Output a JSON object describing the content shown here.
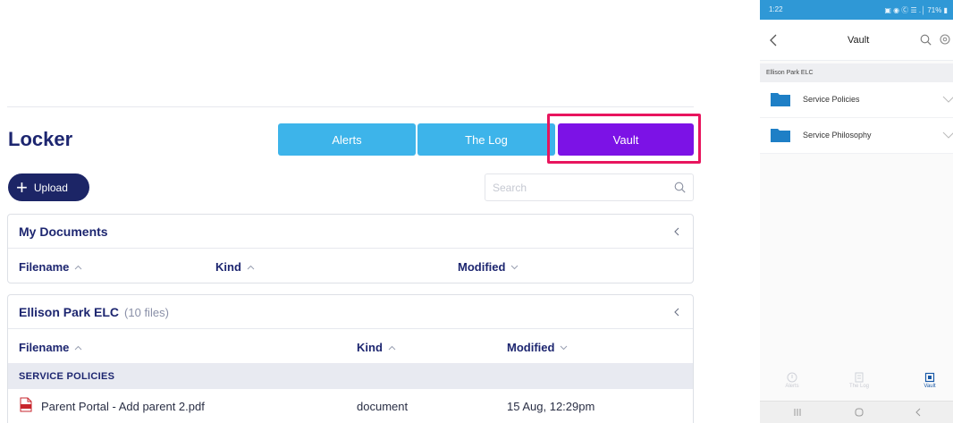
{
  "desktop": {
    "page_title": "Locker",
    "tabs": [
      {
        "label": "Alerts"
      },
      {
        "label": "The Log"
      },
      {
        "label": "Vault"
      }
    ],
    "upload_label": "Upload",
    "search": {
      "placeholder": "Search",
      "value": ""
    },
    "my_documents": {
      "title": "My Documents",
      "columns": [
        "Filename",
        "Kind",
        "Modified"
      ]
    },
    "ellison": {
      "title": "Ellison Park ELC",
      "count": "(10 files)",
      "columns": [
        "Filename",
        "Kind",
        "Modified"
      ],
      "section": "SERVICE POLICIES",
      "rows": [
        {
          "filename": "Parent Portal - Add parent 2.pdf",
          "kind": "document",
          "modified": "15 Aug, 12:29pm"
        }
      ]
    }
  },
  "mobile": {
    "status_time": "1:22",
    "status_right": "▣ ◉ Ⓒ ☰ .│ 71% ▮",
    "title": "Vault",
    "section": "Ellison Park ELC",
    "folders": [
      {
        "label": "Service Policies"
      },
      {
        "label": "Service Philosophy"
      }
    ],
    "nav": [
      {
        "label": "Alerts"
      },
      {
        "label": "The Log"
      },
      {
        "label": "Vault"
      }
    ]
  },
  "colors": {
    "navy": "#1d2670",
    "tab_blue": "#3db4ea",
    "vault_purple": "#7c12e6",
    "highlight": "#e8155e",
    "status_blue": "#2f98d6",
    "folder_blue": "#1e7fc6"
  }
}
